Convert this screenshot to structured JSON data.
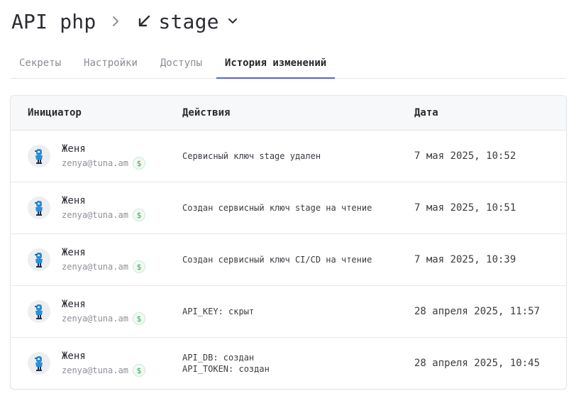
{
  "breadcrumb": {
    "project": "API php",
    "environment": "stage",
    "separator_icon": "chevron-right-icon",
    "environment_icon": "arrow-down-left-icon",
    "dropdown_icon": "chevron-down-icon"
  },
  "tabs": [
    {
      "label": "Секреты",
      "active": false
    },
    {
      "label": "Настройки",
      "active": false
    },
    {
      "label": "Доступы",
      "active": false
    },
    {
      "label": "История изменений",
      "active": true
    }
  ],
  "table": {
    "headers": {
      "initiator": "Инициатор",
      "actions": "Действия",
      "date": "Дата"
    },
    "rows": [
      {
        "name": "Женя",
        "email": "zenya@tuna.am",
        "badge": "$",
        "actions": [
          "Сервисный ключ stage удален"
        ],
        "date": "7 мая 2025, 10:52"
      },
      {
        "name": "Женя",
        "email": "zenya@tuna.am",
        "badge": "$",
        "actions": [
          "Создан сервисный ключ stage на чтение"
        ],
        "date": "7 мая 2025, 10:51"
      },
      {
        "name": "Женя",
        "email": "zenya@tuna.am",
        "badge": "$",
        "actions": [
          "Создан сервисный ключ CI/CD на чтение"
        ],
        "date": "7 мая 2025, 10:39"
      },
      {
        "name": "Женя",
        "email": "zenya@tuna.am",
        "badge": "$",
        "actions": [
          "API_KEY: скрыт"
        ],
        "date": "28 апреля 2025, 11:57"
      },
      {
        "name": "Женя",
        "email": "zenya@tuna.am",
        "badge": "$",
        "actions": [
          "API_DB: создан",
          "API_TOKEN: создан"
        ],
        "date": "28 апреля 2025, 10:45"
      }
    ]
  },
  "colors": {
    "accent": "#5b63c7",
    "badge_green": "#2fa44f",
    "avatar_blue": "#2a8fd6"
  }
}
